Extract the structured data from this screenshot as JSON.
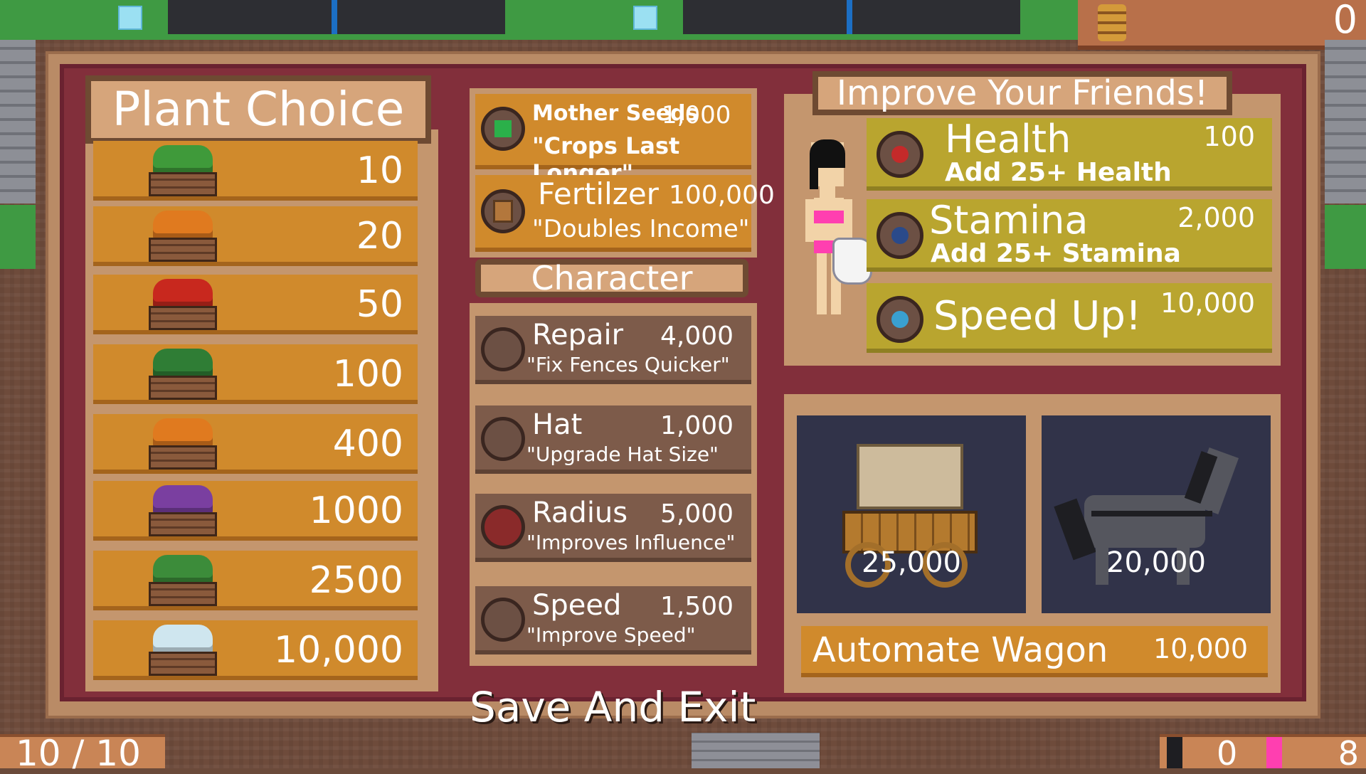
{
  "hud": {
    "coins": "0",
    "lives": "10 / 10",
    "workers_count": "0",
    "friends_count": "8"
  },
  "plant_choice": {
    "title": "Plant Choice",
    "items": [
      {
        "crop": "cabbage-icon",
        "price": "10",
        "color": "#3f9a3a"
      },
      {
        "crop": "carrot-icon",
        "price": "20",
        "color": "#e07a1f"
      },
      {
        "crop": "tomato-icon",
        "price": "50",
        "color": "#c8281e"
      },
      {
        "crop": "beet-icon",
        "price": "100",
        "color": "#2f7d35"
      },
      {
        "crop": "pumpkin-icon",
        "price": "400",
        "color": "#e07a1f"
      },
      {
        "crop": "eggplant-icon",
        "price": "1000",
        "color": "#7a3fa0"
      },
      {
        "crop": "watermelon-icon",
        "price": "2500",
        "color": "#3c8c3a"
      },
      {
        "crop": "crystal-icon",
        "price": "10,000",
        "color": "#cfe6ef"
      }
    ]
  },
  "upgrades": {
    "mother_seeds": {
      "name": "Mother Seeds",
      "price": "1,000",
      "desc": "\"Crops Last Longer\""
    },
    "fertilizer": {
      "name": "Fertilzer",
      "price": "100,000",
      "desc": "\"Doubles Income\""
    },
    "character_title": "Character",
    "character": [
      {
        "name": "Repair",
        "price": "4,000",
        "desc": "\"Fix Fences Quicker\"",
        "icon": "hammer-icon"
      },
      {
        "name": "Hat",
        "price": "1,000",
        "desc": "\"Upgrade Hat Size\"",
        "icon": "hat-icon"
      },
      {
        "name": "Radius",
        "price": "5,000",
        "desc": "\"Improves Influence\"",
        "icon": "radius-icon"
      },
      {
        "name": "Speed",
        "price": "1,500",
        "desc": "\"Improve Speed\"",
        "icon": "boots-icon"
      }
    ]
  },
  "friends": {
    "title": "Improve Your Friends!",
    "items": [
      {
        "name": "Health",
        "price": "100",
        "desc": "Add 25+ Health",
        "icon": "heart-icon"
      },
      {
        "name": "Stamina",
        "price": "2,000",
        "desc": "Add 25+ Stamina",
        "icon": "drop-icon"
      },
      {
        "name": "Speed Up!",
        "price": "10,000",
        "desc": "",
        "icon": "arrow-icon"
      }
    ]
  },
  "vehicles": {
    "wagon_price": "25,000",
    "horse_price": "20,000",
    "automate_label": "Automate Wagon",
    "automate_price": "10,000"
  },
  "save_exit": "Save And Exit"
}
